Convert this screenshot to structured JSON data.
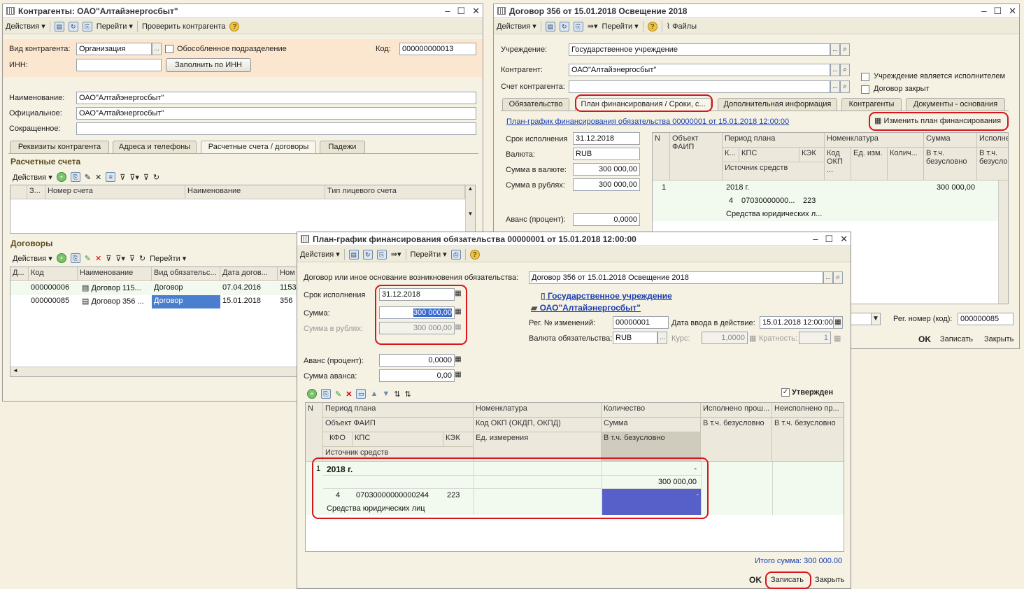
{
  "win1": {
    "title": "Контрагенты: ОАО\"Алтайэнергосбыт\"",
    "toolbar": {
      "actions": "Действия",
      "goto": "Перейти",
      "check": "Проверить контрагента"
    },
    "kind_label": "Вид контрагента:",
    "kind_value": "Организация",
    "separate_label": "Обособленное подразделение",
    "code_label": "Код:",
    "code_value": "000000000013",
    "inn_label": "ИНН:",
    "fill_inn": "Заполнить по ИНН",
    "name_label": "Наименование:",
    "name_value": "ОАО\"Алтайэнергосбыт\"",
    "official_label": "Официальное:",
    "official_value": "ОАО\"Алтайэнергосбыт\"",
    "short_label": "Сокращенное:",
    "tabs": [
      "Реквизиты контрагента",
      "Адреса и телефоны",
      "Расчетные счета / договоры",
      "Падежи"
    ],
    "accounts_title": "Расчетные счета",
    "actions": "Действия",
    "accounts_cols": [
      "З...",
      "Номер счета",
      "Наименование",
      "Тип лицевого счета"
    ],
    "contracts_title": "Договоры",
    "goto": "Перейти",
    "contracts_cols": [
      "Д...",
      "Код",
      "Наименование",
      "Вид обязательс...",
      "Дата догов...",
      "Ном"
    ],
    "contracts_rows": [
      {
        "code": "000000006",
        "name": "Договор 115...",
        "kind": "Договор",
        "date": "07.04.2016",
        "num": "1153"
      },
      {
        "code": "000000085",
        "name": "Договор 356 ...",
        "kind": "Договор",
        "date": "15.01.2018",
        "num": "356"
      }
    ]
  },
  "win2": {
    "title": "Договор 356 от 15.01.2018 Освещение 2018",
    "toolbar": {
      "actions": "Действия",
      "goto": "Перейти",
      "files": "Файлы"
    },
    "institution_label": "Учреждение:",
    "institution_value": "Государственное учреждение",
    "contractor_label": "Контрагент:",
    "contractor_value": "ОАО\"Алтайэнергосбыт\"",
    "account_label": "Счет контрагента:",
    "executor_label": "Учреждение является исполнителем",
    "closed_label": "Договор закрыт",
    "tabs": [
      "Обязательство",
      "План финансирования / Сроки, с...",
      "Дополнительная информация",
      "Контрагенты",
      "Документы - основания"
    ],
    "plan_link": "План-график финансирования обязательства 00000001 от 15.01.2018 12:00:00",
    "change_plan": "Изменить план финансирования",
    "due_label": "Срок исполнения",
    "due_value": "31.12.2018",
    "currency_label": "Валюта:",
    "currency_value": "RUB",
    "sum_cur_label": "Сумма в валюте:",
    "sum_cur_value": "300 000,00",
    "sum_rub_label": "Сумма в рублях:",
    "sum_rub_value": "300 000,00",
    "advance_label": "Аванс (процент):",
    "advance_value": "0,0000",
    "grid_h": {
      "n": "N",
      "faip": "Объект ФАИП",
      "period": "Период плана",
      "k": "К...",
      "kps": "КПС",
      "kek": "КЭК",
      "source": "Источник средств",
      "nom": "Номенклатура",
      "okp": "Код ОКП ...",
      "unit": "Ед. изм.",
      "qty": "Колич...",
      "sum": "Сумма",
      "uncond": "В т.ч. безусловно",
      "exec": "Исполне",
      "exec2": "В т.ч. безусло"
    },
    "grid_r": {
      "n": "1",
      "period": "2018 г.",
      "sum": "300 000,00",
      "k": "4",
      "kps": "07030000000...",
      "kek": "223",
      "source": "Средства юридических л..."
    },
    "reg_num_label": "Рег. номер (код):",
    "reg_num_value": "000000085",
    "ok": "OK",
    "save": "Записать",
    "close": "Закрыть"
  },
  "win3": {
    "title": "План-график финансирования обязательства 00000001 от 15.01.2018 12:00:00",
    "toolbar": {
      "actions": "Действия",
      "goto": "Перейти"
    },
    "basis_label": "Договор или иное основание возникновения обязательства:",
    "basis_value": "Договор 356 от 15.01.2018 Освещение 2018",
    "due_label": "Срок исполнения",
    "due_value": "31.12.2018",
    "sum_label": "Сумма:",
    "sum_value": "300 000,00",
    "sum_rub_label": "Сумма в рублях:",
    "sum_rub_value": "300 000,00",
    "institution_link": "Государственное учреждение",
    "contractor_link": "ОАО\"Алтайэнергосбыт\"",
    "reg_changes_label": "Рег. № изменений:",
    "reg_changes_value": "00000001",
    "date_eff_label": "Дата ввода в действие:",
    "date_eff_value": "15.01.2018 12:00:00",
    "currency_label": "Валюта обязательства:",
    "currency_value": "RUB",
    "rate_label": "Курс:",
    "rate_value": "1,0000",
    "mult_label": "Кратность:",
    "mult_value": "1",
    "advance_label": "Аванс (процент):",
    "advance_value": "0,0000",
    "adv_sum_label": "Сумма аванса:",
    "adv_sum_value": "0,00",
    "approved_label": "Утвержден",
    "grid_h": {
      "n": "N",
      "period": "Период плана",
      "faip": "Объект ФАИП",
      "kfo": "КФО",
      "kps": "КПС",
      "kek": "КЭК",
      "source": "Источник средств",
      "nom": "Номенклатура",
      "okp": "Код ОКП (ОКДП, ОКПД)",
      "unit": "Ед. измерения",
      "qty": "Количество",
      "sum": "Сумма",
      "uncond": "В т.ч. безусловно",
      "executed": "Исполнено прош...",
      "exec_uncond": "В т.ч. безусловно",
      "not_exec": "Неисполнено пр...",
      "notexec_uncond": "В т.ч. безусловно"
    },
    "grid_r": {
      "n": "1",
      "period": "2018 г.",
      "qty": "-",
      "sum": "300 000,00",
      "kfo": "4",
      "kps": "07030000000000244",
      "kek": "223",
      "uncond": "-",
      "source": "Средства юридических лиц"
    },
    "total": "Итого сумма: 300 000.00",
    "ok": "OK",
    "save": "Записать",
    "close": "Закрыть"
  }
}
